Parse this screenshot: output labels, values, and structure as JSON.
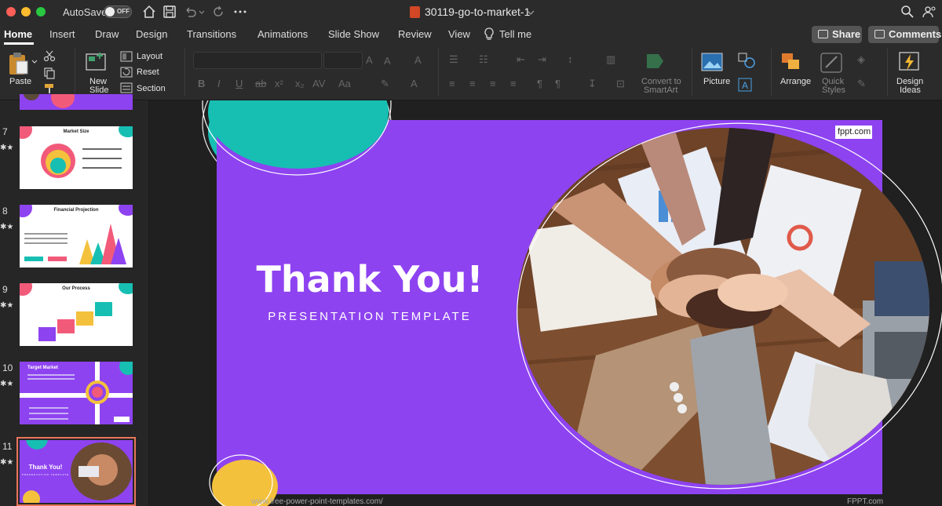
{
  "titlebar": {
    "autosave_label": "AutoSave",
    "autosave_state": "OFF",
    "document_title": "30119-go-to-market-1"
  },
  "tabs": [
    {
      "label": "Home",
      "active": true
    },
    {
      "label": "Insert"
    },
    {
      "label": "Draw"
    },
    {
      "label": "Design"
    },
    {
      "label": "Transitions"
    },
    {
      "label": "Animations"
    },
    {
      "label": "Slide Show"
    },
    {
      "label": "Review"
    },
    {
      "label": "View"
    },
    {
      "label": "Tell me"
    }
  ],
  "actions": {
    "share": "Share",
    "comments": "Comments"
  },
  "ribbon": {
    "paste": "Paste",
    "new_slide_1": "New",
    "new_slide_2": "Slide",
    "layout": "Layout",
    "reset": "Reset",
    "section": "Section",
    "convert_1": "Convert to",
    "convert_2": "SmartArt",
    "picture": "Picture",
    "arrange": "Arrange",
    "quick_styles_1": "Quick",
    "quick_styles_2": "Styles",
    "design_ideas_1": "Design",
    "design_ideas_2": "Ideas"
  },
  "thumbnails": [
    {
      "number": "7",
      "title": "Market Size"
    },
    {
      "number": "8",
      "title": "Financial Projection"
    },
    {
      "number": "9",
      "title": "Our Process"
    },
    {
      "number": "10",
      "title": "Target Market"
    },
    {
      "number": "11",
      "title": "Thank You!",
      "subtitle": "PRESENTATION TEMPLATE",
      "selected": true
    }
  ],
  "slide": {
    "title": "Thank You!",
    "subtitle": "PRESENTATION TEMPLATE",
    "badge": "fppt.com",
    "footer_url": "www.free-power-point-templates.com/",
    "footer_brand": "FPPT.com",
    "background_color": "#8e43f0",
    "accent_teal": "#17bfb3",
    "accent_yellow": "#f4c13c"
  }
}
